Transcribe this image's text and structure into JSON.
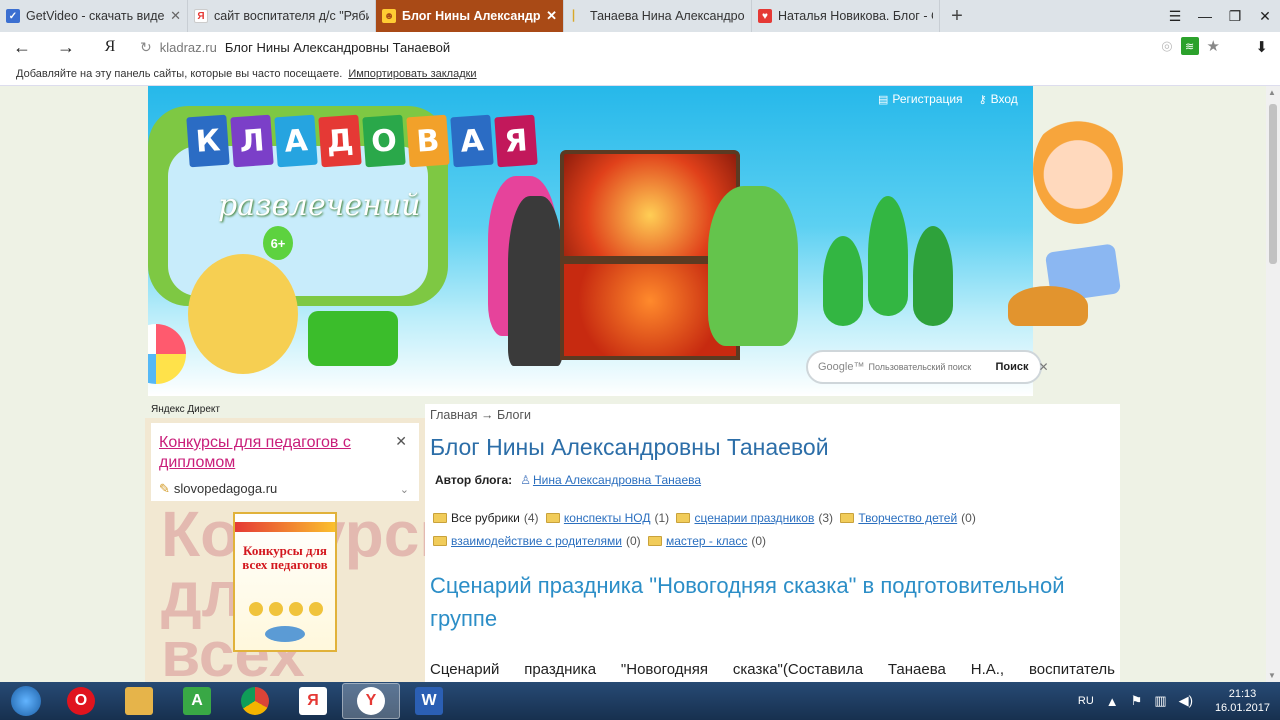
{
  "browser": {
    "tabs": [
      {
        "title": "GetVideo - скачать видео с",
        "favicon": "getvideo-icon",
        "color": "#3b6fd1",
        "active": false
      },
      {
        "title": "сайт воспитателя д/с \"Рябин",
        "favicon": "yandex-icon",
        "color": "#ffffff",
        "active": false
      },
      {
        "title": "Блог Нины Александровн",
        "favicon": "kladraz-icon",
        "color": "#ffcc33",
        "active": true
      },
      {
        "title": "Танаева Нина Александро",
        "favicon": "page-icon",
        "color": "#f2c94c",
        "active": false
      },
      {
        "title": "Наталья Новикова. Блог - С",
        "favicon": "heart-icon",
        "color": "#e53935",
        "active": false
      }
    ],
    "address": {
      "domain": "kladraz.ru",
      "page_title": "Блог Нины Александровны Танаевой"
    },
    "bookmarks_hint": "Добавляйте на эту панель сайты, которые вы часто посещаете.",
    "bookmarks_import": "Импортировать закладки",
    "yandex_label": "Я"
  },
  "site": {
    "logo_letters": [
      "К",
      "Л",
      "А",
      "Д",
      "О",
      "В",
      "А",
      "Я"
    ],
    "logo_colors": [
      "#2b6cc4",
      "#7b3fc8",
      "#26a4e0",
      "#e53935",
      "#2aa84a",
      "#f2a12a",
      "#2b6cc4",
      "#c2185b"
    ],
    "logo_sub": "развлечений",
    "age": "6+",
    "register": "Регистрация",
    "login": "Вход",
    "search_brand": "Google™",
    "search_placeholder": "Пользовательский поиск",
    "search_button": "Поиск"
  },
  "sidebar": {
    "label": "Яндекс Директ",
    "ad_title": "Конкурсы для педагогов с дипломом",
    "ad_url": "slovopedagoga.ru",
    "poster_text": "Конкурсы для всех педагогов"
  },
  "content": {
    "breadcrumb": "Главная → Блоги",
    "blog_title": "Блог Нины Александровны Танаевой",
    "author_label": "Автор блога:",
    "author_name": "Нина Александровна Танаева",
    "categories": [
      {
        "name": "Все рубрики",
        "count": "(4)",
        "link": false
      },
      {
        "name": "конспекты НОД",
        "count": "(1)",
        "link": true
      },
      {
        "name": "сценарии праздников",
        "count": "(3)",
        "link": true
      },
      {
        "name": "Творчество детей",
        "count": "(0)",
        "link": true
      },
      {
        "name": "взаимодействие с родителями",
        "count": "(0)",
        "link": true
      },
      {
        "name": "мастер - класс",
        "count": "(0)",
        "link": true
      }
    ],
    "post_title": "Сценарий праздника \"Новогодняя сказка\" в подготовительной группе",
    "post_excerpt": [
      "Сценарий",
      "праздника",
      "\"Новогодняя",
      "сказка\"(Составила",
      "Танаева",
      "Н.А.,",
      "воспитатель"
    ]
  },
  "taskbar": {
    "language": "RU",
    "time": "21:13",
    "date": "16.01.2017",
    "apps": [
      {
        "name": "opera-icon",
        "label": "O",
        "color": "#e0141e",
        "active": false
      },
      {
        "name": "explorer-icon",
        "label": "",
        "color": "#e6b44a",
        "active": false
      },
      {
        "name": "green-a-icon",
        "label": "A",
        "color": "#39a845",
        "active": false
      },
      {
        "name": "chrome-icon",
        "label": "",
        "color": "#e2b62b",
        "active": false
      },
      {
        "name": "yandex-search-icon",
        "label": "Я",
        "color": "#e53935",
        "active": false
      },
      {
        "name": "yandex-browser-icon",
        "label": "Y",
        "color": "#e53935",
        "active": true
      },
      {
        "name": "word-icon",
        "label": "W",
        "color": "#2b5fb4",
        "active": false
      }
    ]
  }
}
